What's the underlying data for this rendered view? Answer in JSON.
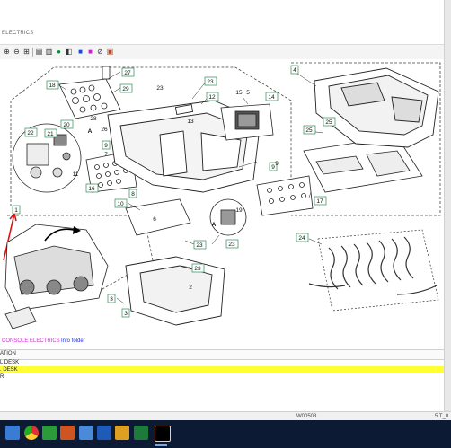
{
  "window": {
    "title": "ELECTRICS"
  },
  "toolbar": {
    "icons": [
      "zoom-in-icon",
      "zoom-out-icon",
      "zoom-fit-icon",
      "zoom-area-icon",
      "print-icon",
      "print-preview-icon",
      "globe-icon",
      "bookmark-icon",
      "tag-icon",
      "blue-square-icon",
      "pink-square-icon",
      "link-icon",
      "color-image-icon"
    ]
  },
  "diagram": {
    "callouts": [
      "1",
      "4",
      "6",
      "7",
      "8",
      "9",
      "9",
      "10",
      "12",
      "13",
      "15",
      "16",
      "17",
      "18",
      "19",
      "20",
      "21",
      "22",
      "23",
      "23",
      "23",
      "23",
      "24",
      "25",
      "25",
      "26",
      "27",
      "28",
      "29",
      "2",
      "3",
      "3",
      "5",
      "A",
      "A",
      "9"
    ]
  },
  "footer": {
    "breadcrumb": "CONSOLE ELECTRICS",
    "info_link": "Info folder"
  },
  "list": {
    "header": "ATION",
    "rows": [
      {
        "text": "L DESK",
        "highlighted": false
      },
      {
        "text": ". DESK",
        "highlighted": true
      },
      {
        "text": "R",
        "highlighted": false
      }
    ]
  },
  "status": {
    "code": "W00503",
    "right": "5 T_0"
  },
  "taskbar": {
    "apps": [
      "windows-start-icon",
      "chrome-icon",
      "edge-icon",
      "app-icon",
      "paint-icon",
      "gallery-icon",
      "app-icon-2",
      "excel-icon",
      "terminal-icon",
      "app-icon-3"
    ],
    "colors": {
      "bar": "#0d1a33",
      "highlight": "#ffff33",
      "callout_green": "#2e8b57",
      "arrow_red": "#d11"
    }
  }
}
